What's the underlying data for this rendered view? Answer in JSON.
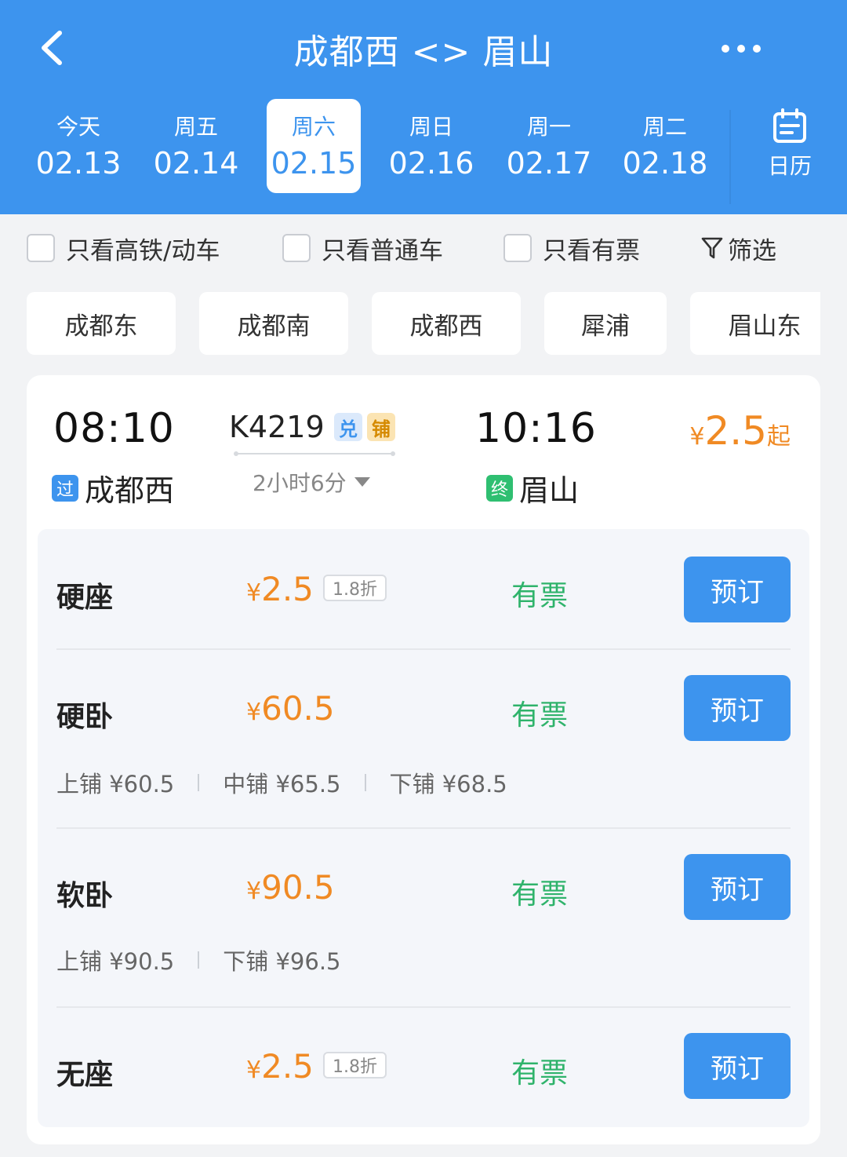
{
  "header": {
    "title": "成都西 <> 眉山",
    "calendar_label": "日历",
    "icons": [
      "chevron-left-icon",
      "more-icon",
      "calendar-icon"
    ]
  },
  "dates": [
    {
      "weekday": "今天",
      "date": "02.13",
      "selected": false
    },
    {
      "weekday": "周五",
      "date": "02.14",
      "selected": false
    },
    {
      "weekday": "周六",
      "date": "02.15",
      "selected": true
    },
    {
      "weekday": "周日",
      "date": "02.16",
      "selected": false
    },
    {
      "weekday": "周一",
      "date": "02.17",
      "selected": false
    },
    {
      "weekday": "周二",
      "date": "02.18",
      "selected": false
    }
  ],
  "filters": {
    "high_speed": "只看高铁/动车",
    "regular": "只看普通车",
    "available": "只看有票",
    "filter_label": "筛选"
  },
  "stations": [
    "成都东",
    "成都南",
    "成都西",
    "犀浦",
    "眉山东"
  ],
  "train": {
    "depart_time": "08:10",
    "arrive_time": "10:16",
    "number": "K4219",
    "tag_exchange": "兑",
    "tag_sleeper": "铺",
    "duration": "2小时6分",
    "depart_badge": "过",
    "depart_station": "成都西",
    "arrive_badge": "终",
    "arrive_station": "眉山",
    "price_currency": "¥",
    "price_from": "2.5",
    "price_suffix": "起"
  },
  "seats": [
    {
      "name": "硬座",
      "currency": "¥",
      "price": "2.5",
      "discount": "1.8折",
      "status": "有票",
      "button": "预订"
    },
    {
      "name": "硬卧",
      "currency": "¥",
      "price": "60.5",
      "status": "有票",
      "button": "预订",
      "berths": [
        "上铺 ¥60.5",
        "中铺 ¥65.5",
        "下铺 ¥68.5"
      ]
    },
    {
      "name": "软卧",
      "currency": "¥",
      "price": "90.5",
      "status": "有票",
      "button": "预订",
      "berths": [
        "上铺 ¥90.5",
        "下铺 ¥96.5"
      ]
    },
    {
      "name": "无座",
      "currency": "¥",
      "price": "2.5",
      "discount": "1.8折",
      "status": "有票",
      "button": "预订"
    }
  ],
  "colors": {
    "primary": "#3d94ee",
    "price": "#f08a24",
    "available": "#2fb36b",
    "background": "#f2f3f5"
  }
}
